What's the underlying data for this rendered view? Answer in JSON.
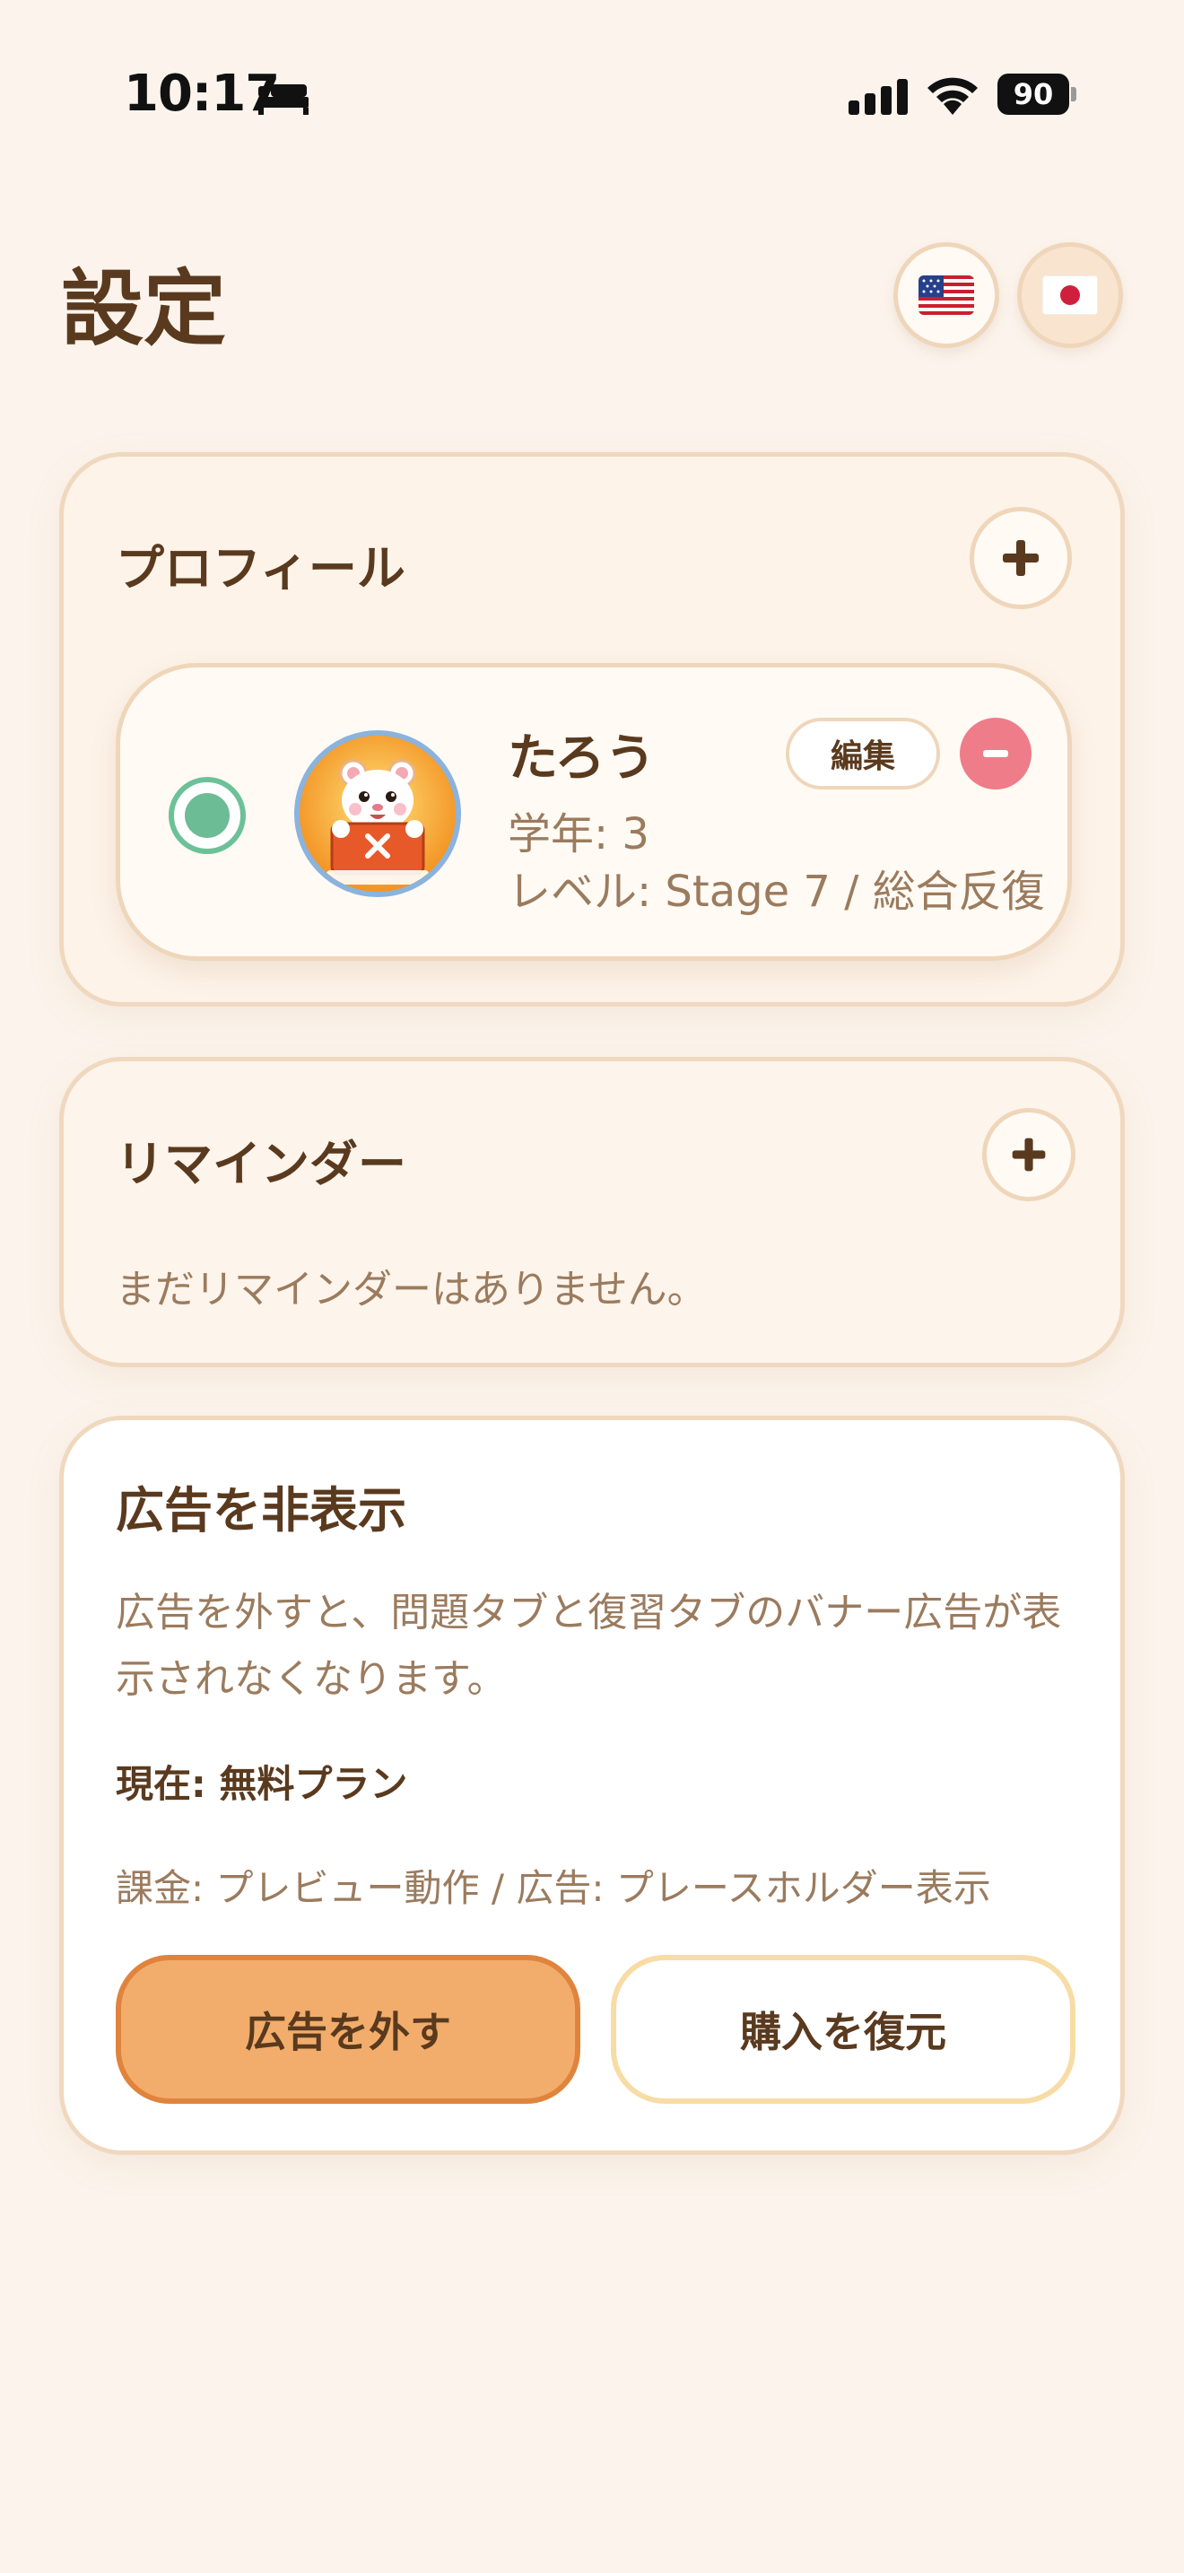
{
  "status_bar": {
    "time": "10:17",
    "battery": "90"
  },
  "header": {
    "title": "設定"
  },
  "languages": [
    {
      "name": "English",
      "icon": "us-flag-icon"
    },
    {
      "name": "日本語",
      "icon": "japan-flag-icon"
    }
  ],
  "profile_section": {
    "title": "プロフィール",
    "profiles": [
      {
        "name": "たろう",
        "grade": "学年: 3",
        "level": "レベル: Stage 7 / 総合反復",
        "edit_label": "編集",
        "selected": true
      }
    ]
  },
  "reminder_section": {
    "title": "リマインダー",
    "empty_message": "まだリマインダーはありません。"
  },
  "ads_section": {
    "title": "広告を非表示",
    "description": "広告を外すと、問題タブと復習タブのバナー広告が表示されなくなります。",
    "current_plan": "現在: 無料プラン",
    "note": "課金: プレビュー動作 / 広告: プレースホルダー表示",
    "remove_label": "広告を外す",
    "restore_label": "購入を復元"
  },
  "colors": {
    "background": "#fcf4ec",
    "text_primary": "#5a3a1e",
    "text_secondary": "#9b7b5e",
    "accent_orange": "#f2ad6c",
    "selected_green": "#6cbc95",
    "delete_pink": "#ef7c89"
  }
}
